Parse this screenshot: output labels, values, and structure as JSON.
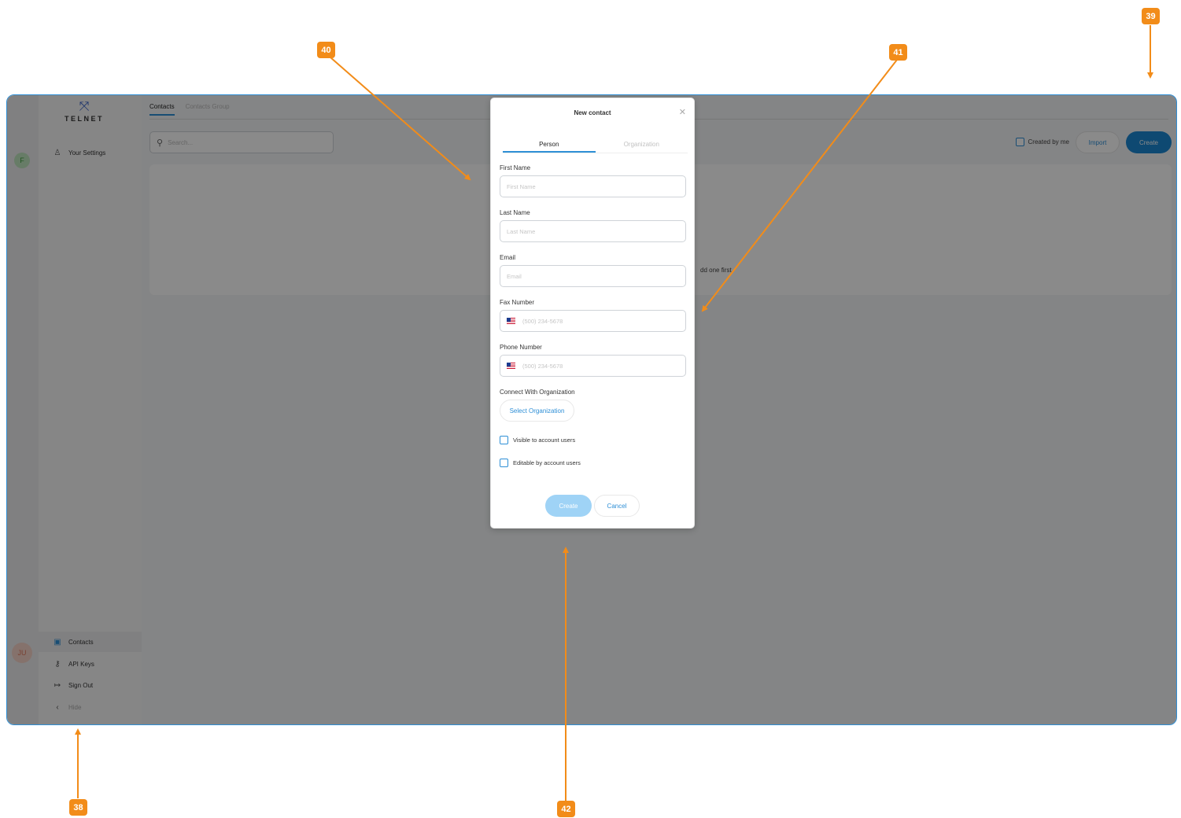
{
  "app": {
    "brand": "TELNET",
    "rail": {
      "avatar_top": "F",
      "avatar_bottom": "JU"
    },
    "sidebar": {
      "top_items": [
        {
          "label": "Your Settings",
          "icon": "user-icon"
        }
      ],
      "bottom_items": [
        {
          "label": "Contacts",
          "icon": "contacts-icon",
          "active": true
        },
        {
          "label": "API Keys",
          "icon": "key-icon"
        },
        {
          "label": "Sign Out",
          "icon": "sign-out-icon"
        },
        {
          "label": "Hide",
          "icon": "chevron-left-icon"
        }
      ]
    },
    "main": {
      "tabs": [
        {
          "label": "Contacts",
          "active": true
        },
        {
          "label": "Contacts Group",
          "active": false
        }
      ],
      "search_placeholder": "Search...",
      "created_by_me_label": "Created by me",
      "import_label": "Import",
      "create_label": "Create",
      "empty_text": "dd one first"
    }
  },
  "modal": {
    "title": "New contact",
    "tabs": [
      {
        "label": "Person",
        "active": true
      },
      {
        "label": "Organization",
        "active": false
      }
    ],
    "fields": [
      {
        "label": "First Name",
        "placeholder": "First Name"
      },
      {
        "label": "Last Name",
        "placeholder": "Last Name"
      },
      {
        "label": "Email",
        "placeholder": "Email"
      },
      {
        "label": "Fax Number",
        "placeholder": "(500) 234-5678",
        "flag": true
      },
      {
        "label": "Phone Number",
        "placeholder": "(500) 234-5678",
        "flag": true
      }
    ],
    "org_label": "Connect With Organization",
    "select_org_label": "Select Organization",
    "checkboxes": [
      "Visible to account users",
      "Editable by account users"
    ],
    "create_label": "Create",
    "cancel_label": "Cancel"
  },
  "annotations": [
    "38",
    "39",
    "40",
    "41",
    "42"
  ],
  "colors": {
    "accent": "#2e8fd6",
    "annotation": "#f28c19",
    "overlay": "rgba(0,0,0,0.46)"
  }
}
